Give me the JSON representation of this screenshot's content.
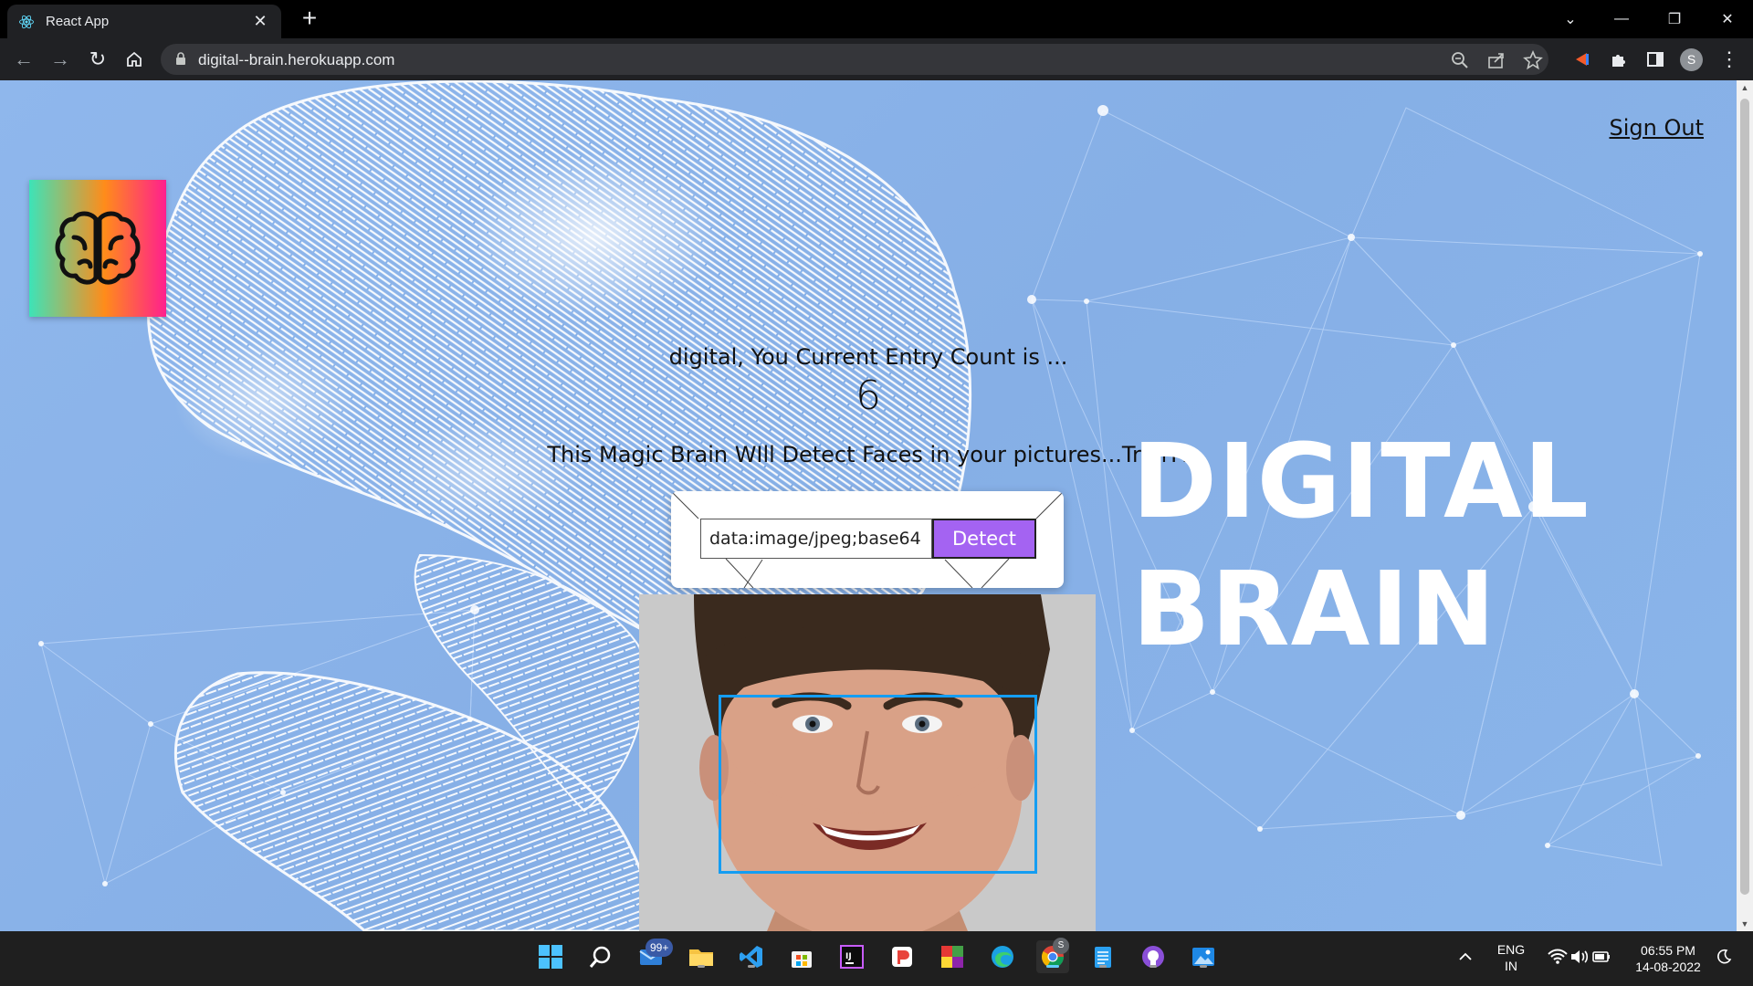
{
  "browser": {
    "tab_title": "React App",
    "url": "digital--brain.herokuapp.com",
    "profile_initial": "S"
  },
  "page": {
    "signout_label": "Sign Out",
    "entry_line": "digital, You Current Entry Count is ...",
    "entry_count": "6",
    "tagline": "This Magic Brain WIll Detect Faces in your pictures...Try iT!",
    "title_line1": "DIGITAL",
    "title_line2": "BRAIN",
    "image_input_value": "data:image/jpeg;base64",
    "detect_label": "Detect",
    "colors": {
      "button": "#a463f2",
      "face_box": "#149df2",
      "title": "#ffffff"
    }
  },
  "taskbar": {
    "mail_badge": "99+",
    "chrome_badge": "S",
    "language_line1": "ENG",
    "language_line2": "IN",
    "time": "06:55 PM",
    "date": "14-08-2022"
  }
}
